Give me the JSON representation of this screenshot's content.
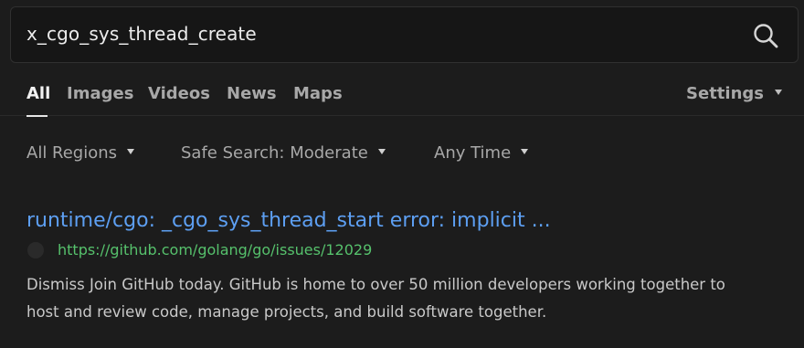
{
  "search": {
    "query": "x_cgo_sys_thread_create",
    "icon": "search-icon"
  },
  "nav": {
    "tabs": [
      {
        "label": "All",
        "active": true
      },
      {
        "label": "Images",
        "active": false
      },
      {
        "label": "Videos",
        "active": false
      },
      {
        "label": "News",
        "active": false
      },
      {
        "label": "Maps",
        "active": false
      }
    ],
    "settings_label": "Settings"
  },
  "filters": {
    "region": "All Regions",
    "safe_search": "Safe Search: Moderate",
    "time": "Any Time"
  },
  "result": {
    "title": "runtime/cgo: _cgo_sys_thread_start error: implicit ...",
    "url": "https://github.com/golang/go/issues/12029",
    "snippet": "Dismiss Join GitHub today. GitHub is home to over 50 million developers working together to host and review code, manage projects, and build software together."
  },
  "colors": {
    "background": "#1c1c1c",
    "link": "#5d9ff2",
    "url": "#56c16c",
    "text": "#c9c9c9"
  }
}
